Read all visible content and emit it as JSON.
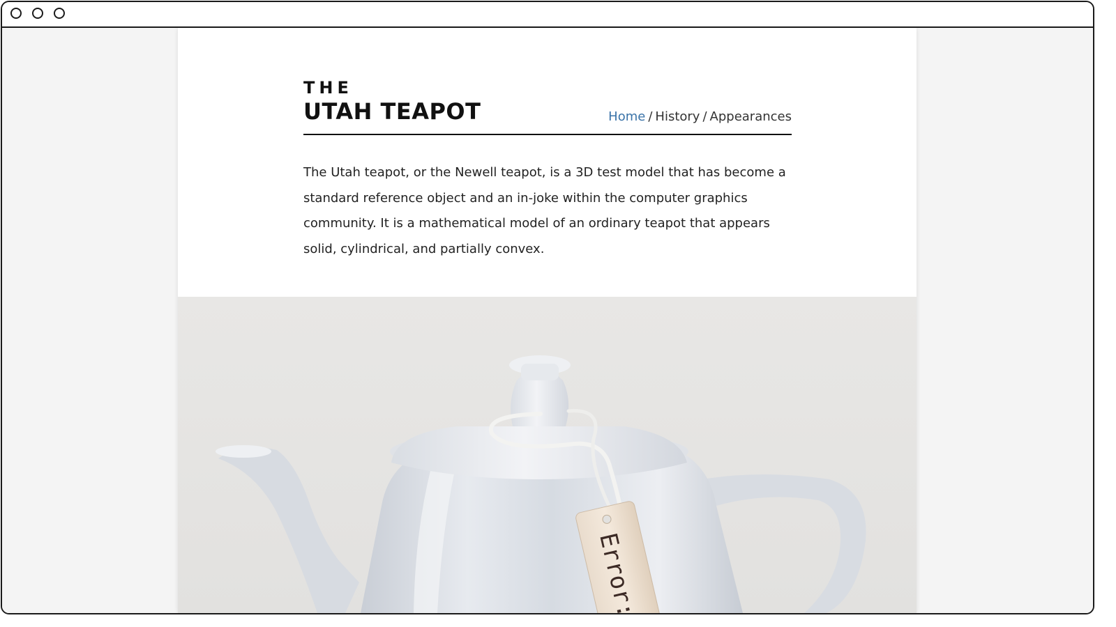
{
  "site": {
    "logo_top": "THE",
    "logo_main": "UTAH TEAPOT"
  },
  "nav": {
    "home": "Home",
    "separator": "/",
    "history": "History",
    "appearances": "Appearances",
    "active_color": "#3a73a8"
  },
  "intro": {
    "text": "The Utah teapot, or the Newell teapot, is a 3D test model that has become a standard reference object and an in-joke within the computer graphics community. It is a mathematical model of an ordinary teapot that appears solid, cylindrical, and partially convex."
  },
  "hero": {
    "tag_text": "Error:"
  },
  "icons": {
    "window_controls": [
      "close-icon",
      "minimize-icon",
      "zoom-icon"
    ]
  }
}
